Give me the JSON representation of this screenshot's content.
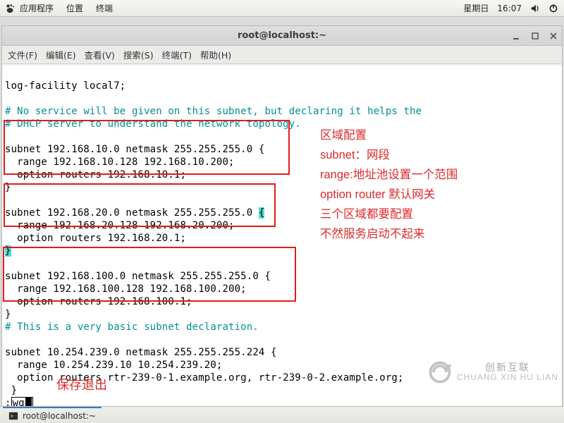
{
  "os_bar": {
    "apps": "应用程序",
    "places": "位置",
    "terminal": "终端",
    "day": "星期日",
    "time": "16:07"
  },
  "window": {
    "title": "root@localhost:~",
    "menus": {
      "file": "文件(F)",
      "edit": "编辑(E)",
      "view": "查看(V)",
      "search": "搜索(S)",
      "terminal": "终端(T)",
      "help": "帮助(H)"
    }
  },
  "term": {
    "l1": "log-facility local7;",
    "l2": "",
    "l3": "# No service will be given on this subnet, but declaring it helps the",
    "l4": "# DHCP server to understand the network topology.",
    "l5": "",
    "l6": "subnet 192.168.10.0 netmask 255.255.255.0 {",
    "l7": "  range 192.168.10.128 192.168.10.200;",
    "l8": "  option routers 192.168.10.1;",
    "l9": "}",
    "l10": "",
    "l11": "subnet 192.168.20.0 netmask 255.255.255.0 ",
    "l11b": "{",
    "l12": "  range 192.168.20.128 192.168.20.200;",
    "l13": "  option routers 192.168.20.1;",
    "l14": "}",
    "l15": "",
    "l16": "subnet 192.168.100.0 netmask 255.255.255.0 {",
    "l17": "  range 192.168.100.128 192.168.100.200;",
    "l18": "  option routers 192.168.100.1;",
    "l19": "}",
    "l20": "# This is a very basic subnet declaration.",
    "l21": "",
    "l22": "subnet 10.254.239.0 netmask 255.255.255.224 {",
    "l23": "  range 10.254.239.10 10.254.239.20;",
    "l24": "  option routers rtr-239-0-1.example.org, rtr-239-0-2.example.org;",
    "l25": " }",
    "l26a": ":",
    "l26b": "wq"
  },
  "annotations": {
    "r1": "区域配置",
    "r2": "subnet：网段",
    "r3": "range:地址池设置一个范围",
    "r4": "option router 默认网关",
    "r5": "三个区域都要配置",
    "r6": "不然服务启动不起来",
    "wq": "保存退出"
  },
  "watermark": {
    "cn": "创新互联",
    "en": "CHUANG XIN HU LIAN"
  },
  "taskbar": {
    "task1": "root@localhost:~"
  }
}
